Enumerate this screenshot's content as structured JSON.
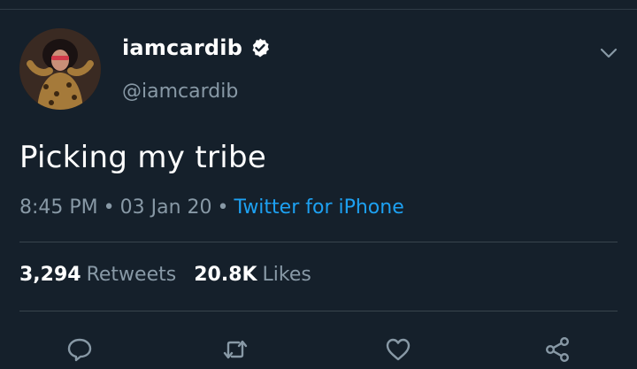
{
  "tweet": {
    "display_name": "iamcardib",
    "handle": "@iamcardib",
    "verified": true,
    "text": "Picking my tribe",
    "time": "8:45 PM",
    "date": "03 Jan 20",
    "separator": "•",
    "source": "Twitter for iPhone",
    "retweets_count": "3,294",
    "retweets_label": "Retweets",
    "likes_count": "20.8K",
    "likes_label": "Likes"
  },
  "icons": {
    "menu": "chevron-down-icon",
    "verified": "verified-badge-icon",
    "reply": "reply-icon",
    "retweet": "retweet-icon",
    "like": "heart-icon",
    "share": "share-icon"
  },
  "colors": {
    "background": "#15202b",
    "text": "#ffffff",
    "muted": "#8899a6",
    "link": "#1da1f2",
    "divider": "#38444d"
  }
}
